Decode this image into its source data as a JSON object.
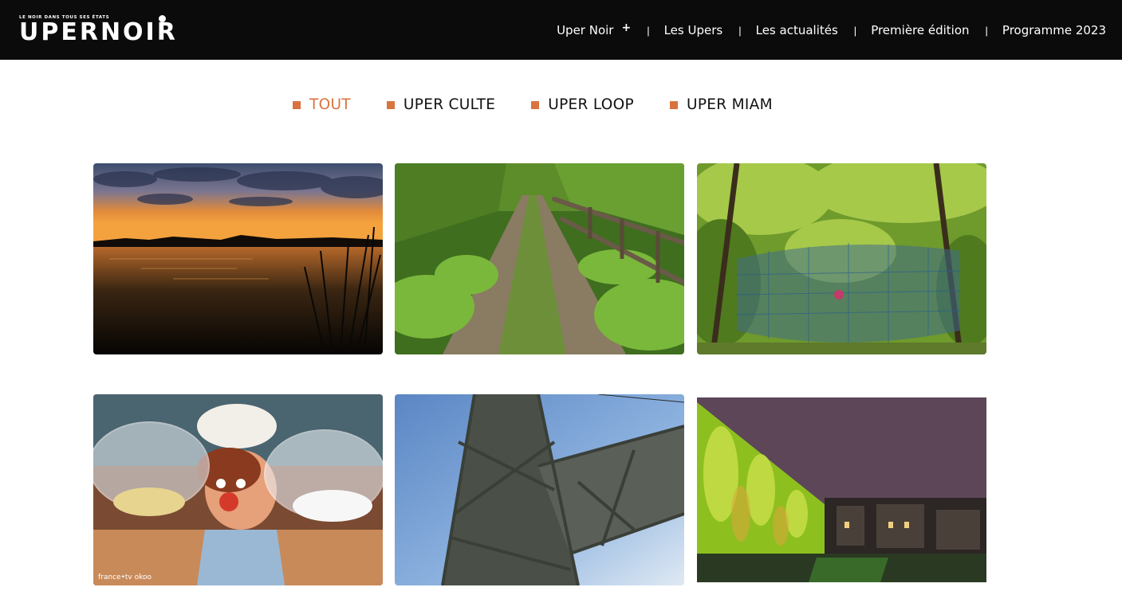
{
  "header": {
    "logo_tagline": "LE NOIR DANS TOUS SES ÉTATS",
    "logo_text": "UPERNOIR",
    "nav": [
      {
        "label": "Uper Noir",
        "has_submenu": true
      },
      {
        "label": "Les Upers"
      },
      {
        "label": "Les actualités"
      },
      {
        "label": "Première édition"
      },
      {
        "label": "Programme 2023"
      }
    ],
    "submenu_glyph": "+",
    "separator": "|"
  },
  "filters": [
    {
      "label": "TOUT",
      "active": true
    },
    {
      "label": "UPER CULTE",
      "active": false
    },
    {
      "label": "UPER LOOP",
      "active": false
    },
    {
      "label": "UPER MIAM",
      "active": false
    }
  ],
  "colors": {
    "accent": "#d9733f",
    "header_bg": "#0b0b0b",
    "text": "#111111"
  },
  "gallery": {
    "tiles": [
      {
        "subject": "sunset-lake-image"
      },
      {
        "subject": "country-path-image"
      },
      {
        "subject": "tree-net-image"
      },
      {
        "subject": "cartoon-character-image",
        "watermark": "france•tv   okoo"
      },
      {
        "subject": "mine-headframe-image"
      },
      {
        "subject": "illuminated-wall-image"
      }
    ]
  }
}
